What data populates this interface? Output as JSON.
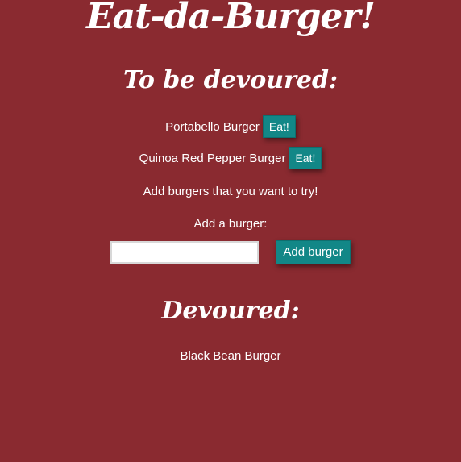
{
  "header": {
    "title": "Eat-da-Burger!"
  },
  "to_devour": {
    "heading": "To be devoured:",
    "items": [
      {
        "name": "Portabello Burger",
        "button_label": "Eat!"
      },
      {
        "name": "Quinoa Red Pepper Burger",
        "button_label": "Eat!"
      }
    ],
    "hint": "Add burgers that you want to try!"
  },
  "form": {
    "label": "Add a burger:",
    "input_value": "",
    "submit_label": "Add burger"
  },
  "devoured": {
    "heading": "Devoured:",
    "items": [
      {
        "name": "Black Bean Burger"
      }
    ]
  },
  "colors": {
    "background": "#8a2a30",
    "button": "#128787",
    "text": "#ffffff"
  }
}
